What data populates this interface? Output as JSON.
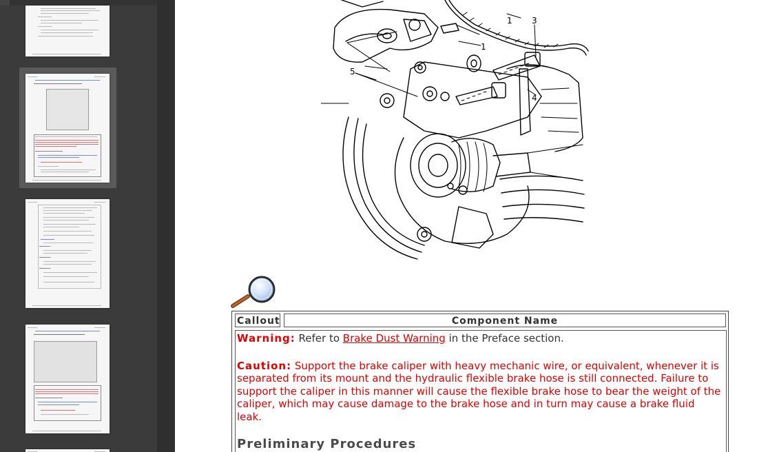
{
  "sidebar": {
    "thumbnails": [
      {
        "name": "page-thumb-1",
        "selected": false
      },
      {
        "name": "page-thumb-2",
        "selected": true
      },
      {
        "name": "page-thumb-3",
        "selected": false
      },
      {
        "name": "page-thumb-4",
        "selected": false
      }
    ]
  },
  "diagram": {
    "callouts": [
      "1",
      "1",
      "3",
      "5",
      "4"
    ]
  },
  "magnifier_icon": "magnifying-glass-icon",
  "table": {
    "header_callout": "Callout",
    "header_component": "Component Name",
    "warning_label": "Warning:",
    "warning_pre": " Refer to ",
    "warning_link": "Brake Dust Warning",
    "warning_post": " in the Preface section.",
    "caution_label": "Caution:",
    "caution_line1": " Support the brake caliper with heavy mechanic wire, or equivalent, whenever it is",
    "caution_line2": "separated from its mount and the hydraulic flexible brake hose is still connected. Failure to",
    "caution_line3": "support the caliper in this manner will cause the flexible brake hose to bear the weight of the",
    "caution_line4": "caliper, which may cause damage to the brake hose and in turn may cause a brake fluid",
    "caution_line5": "leak.",
    "section_heading": "Preliminary Procedures"
  },
  "colors": {
    "sidebar_bg": "#3b3b3b",
    "warning_red": "#e00000",
    "text": "#333333"
  }
}
